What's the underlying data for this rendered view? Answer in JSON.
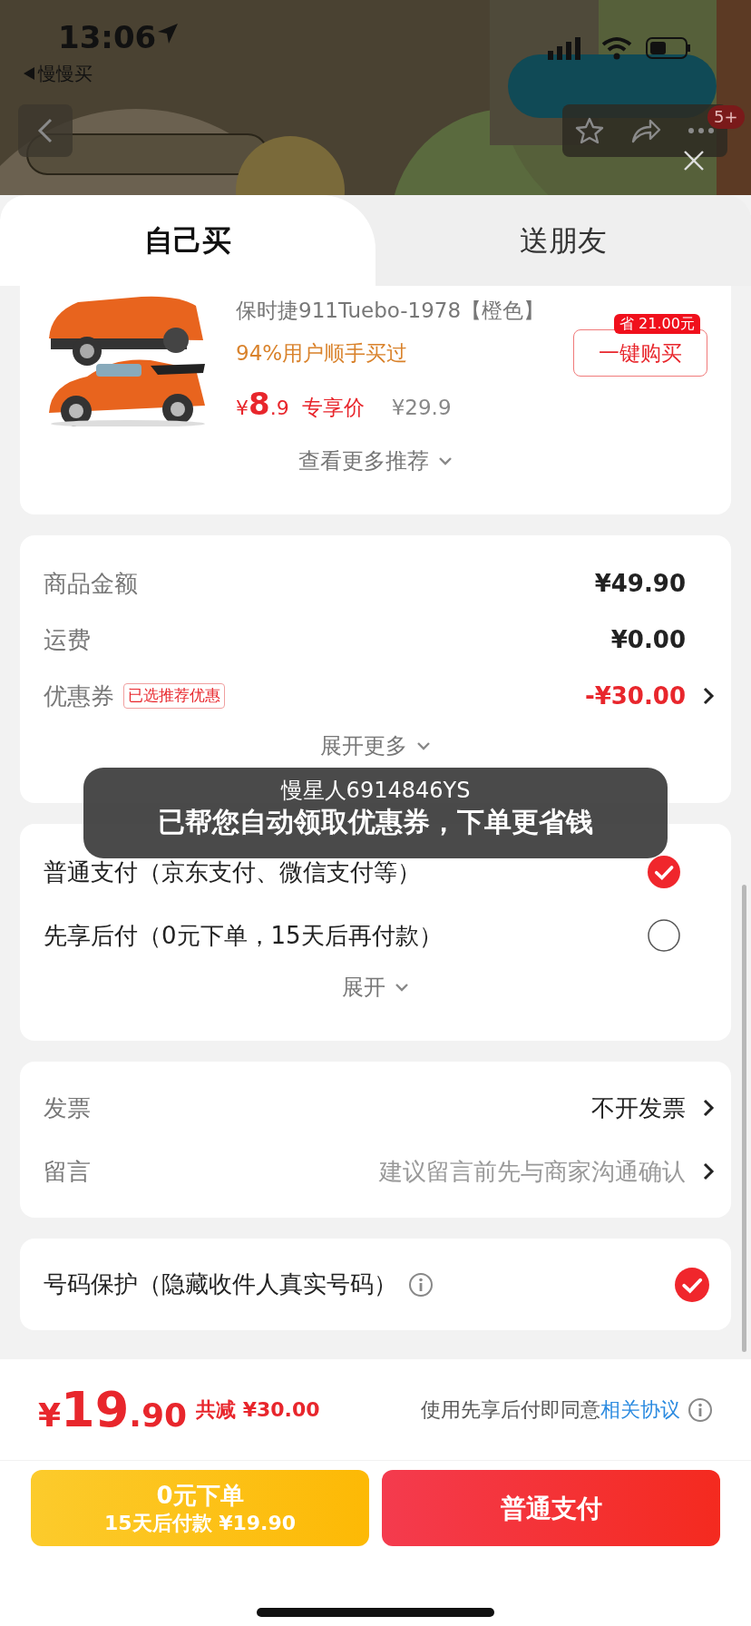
{
  "status_bar": {
    "time": "13:06",
    "back_app": "慢慢买"
  },
  "header": {
    "badge": "5+"
  },
  "tabs": [
    {
      "label": "自己买",
      "selected": true
    },
    {
      "label": "送朋友",
      "selected": false
    }
  ],
  "recommendation": {
    "title": "保时捷911Tuebo-1978【橙色】",
    "social_proof": "94%用户顺手买过",
    "price_symbol": "¥",
    "price_int": "8",
    "price_dec": ".9",
    "price_label": "专享价",
    "original_price": "¥29.9",
    "saving_badge": "省 21.00元",
    "buy_button": "一键购买",
    "more": "查看更多推荐"
  },
  "price_summary": {
    "rows": [
      {
        "label": "商品金额",
        "value": "¥49.90",
        "kind": "plain"
      },
      {
        "label": "运费",
        "value": "¥0.00",
        "kind": "plain"
      },
      {
        "label": "优惠券",
        "tag": "已选推荐优惠",
        "value": "-¥30.00",
        "kind": "discount"
      }
    ],
    "expand": "展开更多"
  },
  "toast": {
    "user": "慢星人6914846YS",
    "message": "已帮您自动领取优惠券，下单更省钱"
  },
  "payment": {
    "options": [
      {
        "label": "普通支付（京东支付、微信支付等）",
        "selected": true
      },
      {
        "label": "先享后付（0元下单，15天后再付款）",
        "selected": false
      }
    ],
    "expand": "展开"
  },
  "extras": [
    {
      "label": "发票",
      "value": "不开发票",
      "kind": "value"
    },
    {
      "label": "留言",
      "value": "建议留言前先与商家沟通确认",
      "kind": "hint"
    }
  ],
  "phone_protection": {
    "label": "号码保护（隐藏收件人真实号码）",
    "checked": true
  },
  "footer": {
    "currency": "¥",
    "total_int": "19",
    "total_dec": ".90",
    "reduction": "共减 ¥30.00",
    "agreement_text": "使用先享后付即同意",
    "agreement_link": "相关协议",
    "buttons": [
      {
        "kind": "later",
        "line1": "0元下单",
        "line2": "15天后付款 ¥19.90"
      },
      {
        "kind": "pay",
        "line1": "普通支付"
      }
    ]
  }
}
